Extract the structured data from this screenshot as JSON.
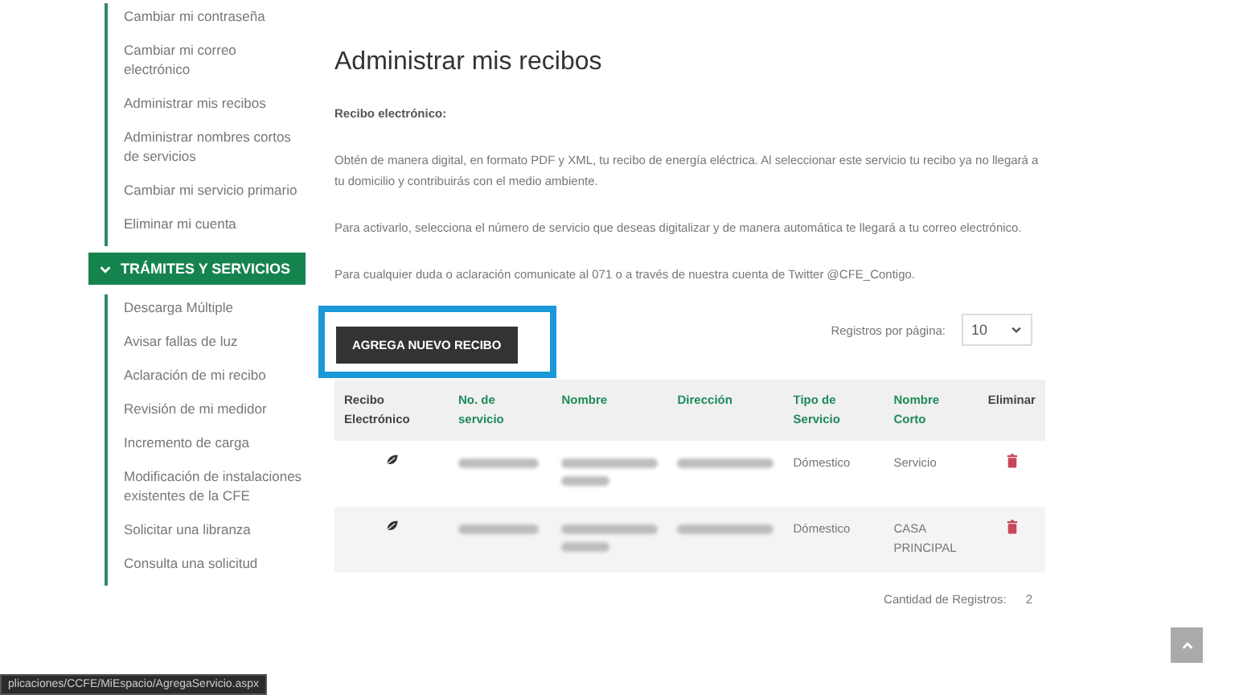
{
  "sidebar": {
    "account_items": [
      "Cambiar mi contraseña",
      "Cambiar mi correo electrónico",
      "Administrar mis recibos",
      "Administrar nombres cortos de servicios",
      "Cambiar mi servicio primario",
      "Eliminar mi cuenta"
    ],
    "section": {
      "title": "TRÁMITES Y SERVICIOS",
      "expanded": true,
      "items": [
        "Descarga Múltiple",
        "Avisar fallas de luz",
        "Aclaración de mi recibo",
        "Revisión de mi medidor",
        "Incremento de carga",
        "Modificación de instalaciones existentes de la CFE",
        "Solicitar una libranza",
        "Consulta una solicitud"
      ]
    }
  },
  "main": {
    "title": "Administrar mis recibos",
    "subtitle": "Recibo electrónico:",
    "paragraphs": [
      "Obtén de manera digital, en formato PDF y XML, tu recibo de energía eléctrica. Al seleccionar este servicio tu recibo ya no llegará a tu domicilio y contribuirás con el medio ambiente.",
      "Para activarlo, selecciona el número de servicio que deseas digitalizar y de manera automática te llegará a tu correo electrónico.",
      "Para cualquier duda o aclaración comunicate al 071 o a través de nuestra cuenta de Twitter @CFE_Contigo."
    ],
    "add_button": {
      "label": "AGREGA NUEVO RECIBO",
      "highlighted": true
    },
    "page_size": {
      "label": "Registros por página:",
      "value": "10"
    },
    "table": {
      "columns": [
        {
          "label": "Recibo Electrónico",
          "sortable": false
        },
        {
          "label": "No. de servicio",
          "sortable": true
        },
        {
          "label": "Nombre",
          "sortable": true
        },
        {
          "label": "Dirección",
          "sortable": true
        },
        {
          "label": "Tipo de Servicio",
          "sortable": true
        },
        {
          "label": "Nombre Corto",
          "sortable": true
        },
        {
          "label": "Eliminar",
          "sortable": false
        }
      ],
      "rows": [
        {
          "service_type": "Dómestico",
          "short_name": "Servicio"
        },
        {
          "service_type": "Dómestico",
          "short_name": "CASA PRINCIPAL"
        }
      ]
    },
    "total": {
      "label": "Cantidad de Registros:",
      "value": "2"
    }
  },
  "status_bar": {
    "url": "plicaciones/CCFE/MiEspacio/AgregaServicio.aspx"
  }
}
